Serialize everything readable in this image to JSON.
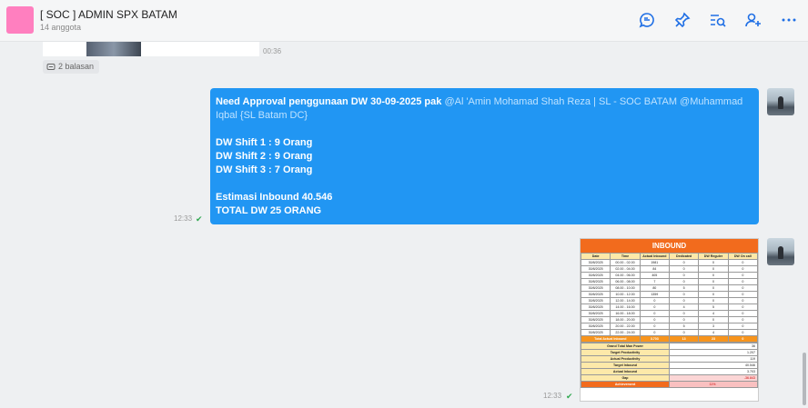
{
  "header": {
    "title": "[ SOC ] ADMIN SPX BATAM",
    "subtitle": "14 anggota",
    "avatar_color": "#ff7fbf",
    "actions": [
      "chat-bubble-icon",
      "pin-icon",
      "search-list-icon",
      "add-member-icon",
      "more-icon"
    ]
  },
  "prev_message": {
    "time": "00:36",
    "replies": "2 balasan"
  },
  "message1": {
    "intro": "Need Approval penggunaan DW 30-09-2025 pak ",
    "mention": "@Al 'Amin Mohamad Shah Reza | SL - SOC BATAM @Muhammad Iqbal {SL Batam DC}",
    "shifts": [
      "DW Shift 1 : 9 Orang",
      "DW Shift 2 : 9 Orang",
      "DW Shift 3 : 7  Orang"
    ],
    "estimate": "Estimasi Inbound 40.546",
    "total": "TOTAL DW 25 ORANG",
    "time": "12:33",
    "status": "✔"
  },
  "message2": {
    "time": "12:33",
    "status": "✔",
    "sheet": {
      "title": "INBOUND",
      "columns": [
        "Date",
        "Time",
        "Actual Inbound",
        "Dedicated",
        "DW Reguler",
        "DW On call"
      ],
      "rows": [
        [
          "30/8/2025",
          "00.00 - 02.00",
          "1981",
          "0",
          "0",
          "0"
        ],
        [
          "30/8/2025",
          "02.00 - 04.00",
          "84",
          "0",
          "0",
          "0"
        ],
        [
          "30/8/2025",
          "04.00 - 06.00",
          "405",
          "0",
          "0",
          "0"
        ],
        [
          "30/8/2025",
          "06.00 - 08.00",
          "7",
          "0",
          "0",
          "0"
        ],
        [
          "30/8/2025",
          "08.00 - 10.00",
          "80",
          "5",
          "0",
          "0"
        ],
        [
          "30/8/2025",
          "10.00 - 12.00",
          "1359",
          "0",
          "0",
          "0"
        ],
        [
          "30/8/2025",
          "12.00 - 14.00",
          "0",
          "0",
          "0",
          "0"
        ],
        [
          "30/8/2025",
          "14.00 - 16.00",
          "0",
          "4",
          "5",
          "0"
        ],
        [
          "30/8/2025",
          "16.00 - 18.00",
          "0",
          "0",
          "4",
          "0"
        ],
        [
          "30/8/2025",
          "18.00 - 20.00",
          "0",
          "0",
          "0",
          "0"
        ],
        [
          "30/8/2025",
          "20.00 - 22.00",
          "0",
          "5",
          "3",
          "0"
        ],
        [
          "30/8/2025",
          "22.00 - 24.00",
          "0",
          "0",
          "4",
          "0"
        ]
      ],
      "total_row": [
        "Total Actual Inbound",
        "3.703",
        "13",
        "23",
        "0"
      ],
      "summary": [
        {
          "label": "Grand Total Man Power",
          "value": "36"
        },
        {
          "label": "Target Productivity",
          "value": "1.207"
        },
        {
          "label": "Actual Productivity",
          "value": "119"
        },
        {
          "label": "Target Inbound",
          "value": "40.546"
        },
        {
          "label": "Actual Inbound",
          "value": "3.703"
        },
        {
          "label": "Gap",
          "value": "-36.843"
        }
      ],
      "achievement": {
        "label": "Achievement",
        "value": "11%"
      }
    }
  }
}
